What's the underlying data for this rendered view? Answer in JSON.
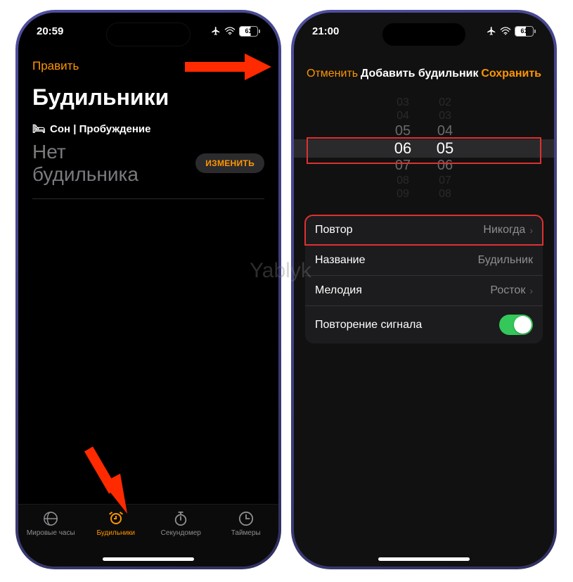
{
  "watermark": "Yablyk",
  "left": {
    "status": {
      "time": "20:59",
      "battery": "61"
    },
    "nav": {
      "edit": "Править",
      "plus": "+"
    },
    "title": "Будильники",
    "sleep_section": "Сон | Пробуждение",
    "no_alarm": "Нет будильника",
    "change": "ИЗМЕНИТЬ",
    "tabs": {
      "world": "Мировые часы",
      "alarms": "Будильники",
      "stopwatch": "Секундомер",
      "timers": "Таймеры"
    }
  },
  "right": {
    "status": {
      "time": "21:00",
      "battery": "61"
    },
    "nav": {
      "cancel": "Отменить",
      "title": "Добавить будильник",
      "save": "Сохранить"
    },
    "picker": {
      "rows_above": [
        [
          "03",
          "02"
        ],
        [
          "04",
          "03"
        ],
        [
          "05",
          "04"
        ]
      ],
      "selected": [
        "06",
        "05"
      ],
      "rows_below": [
        [
          "07",
          "06"
        ],
        [
          "08",
          "07"
        ],
        [
          "09",
          "08"
        ]
      ]
    },
    "settings": {
      "repeat": {
        "label": "Повтор",
        "value": "Никогда"
      },
      "name": {
        "label": "Название",
        "value": "Будильник"
      },
      "sound": {
        "label": "Мелодия",
        "value": "Росток"
      },
      "snooze": {
        "label": "Повторение сигнала",
        "on": true
      }
    }
  }
}
